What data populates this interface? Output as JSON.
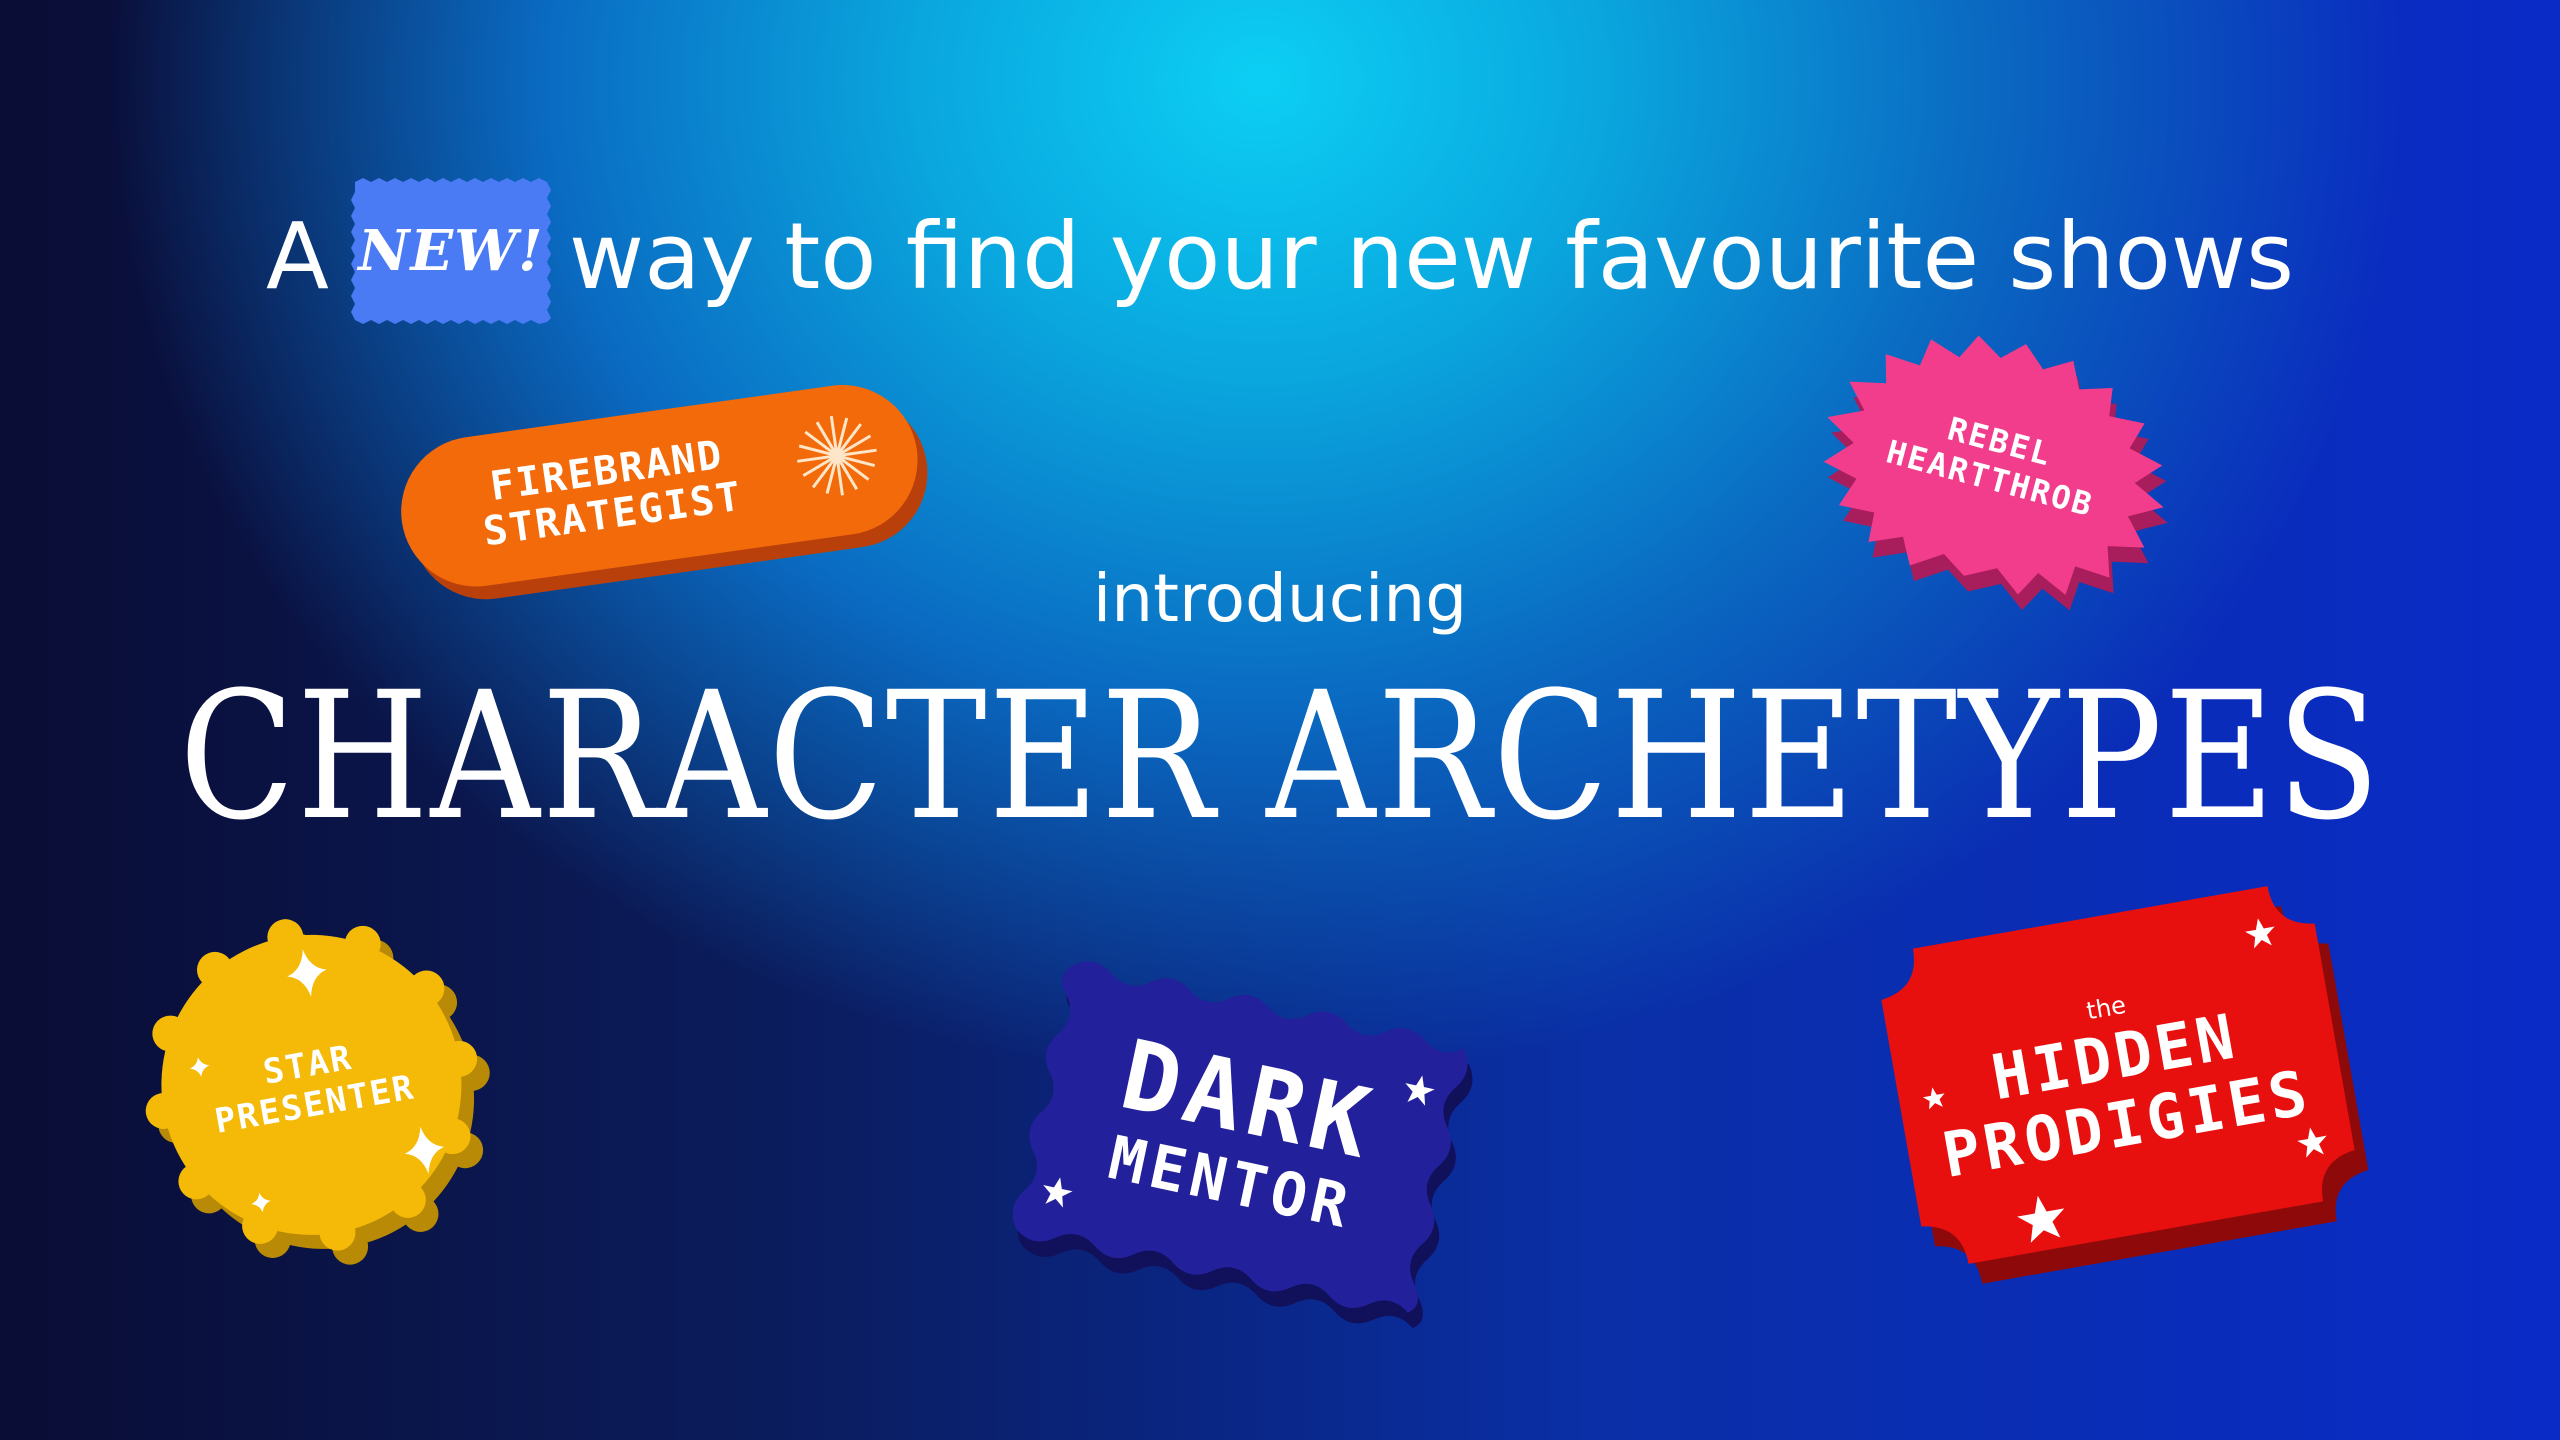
{
  "headline": {
    "prefix": "A",
    "badge": "NEW!",
    "suffix": "way to find your new favourite shows"
  },
  "intro": "introducing",
  "title": "CHARACTER ARCHETYPES",
  "stickers": {
    "firebrand": {
      "line1": "FIREBRAND",
      "line2": "STRATEGIST",
      "color": "#f26a0a"
    },
    "rebel": {
      "line1": "REBEL",
      "line2": "HEARTTHROB",
      "color": "#f23d8c"
    },
    "star": {
      "line1": "STAR",
      "line2": "PRESENTER",
      "color": "#f5b907"
    },
    "dark": {
      "line1": "DARK",
      "line2": "MENTOR",
      "color": "#22209a"
    },
    "hidden": {
      "small": "the",
      "line1": "HIDDEN",
      "line2": "PRODIGIES",
      "color": "#e8100f"
    }
  },
  "colors": {
    "new_badge": "#4a7bf5",
    "text": "#ffffff"
  },
  "icons": [
    "sparkle-burst-icon",
    "sparkle-icon",
    "star-icon"
  ]
}
